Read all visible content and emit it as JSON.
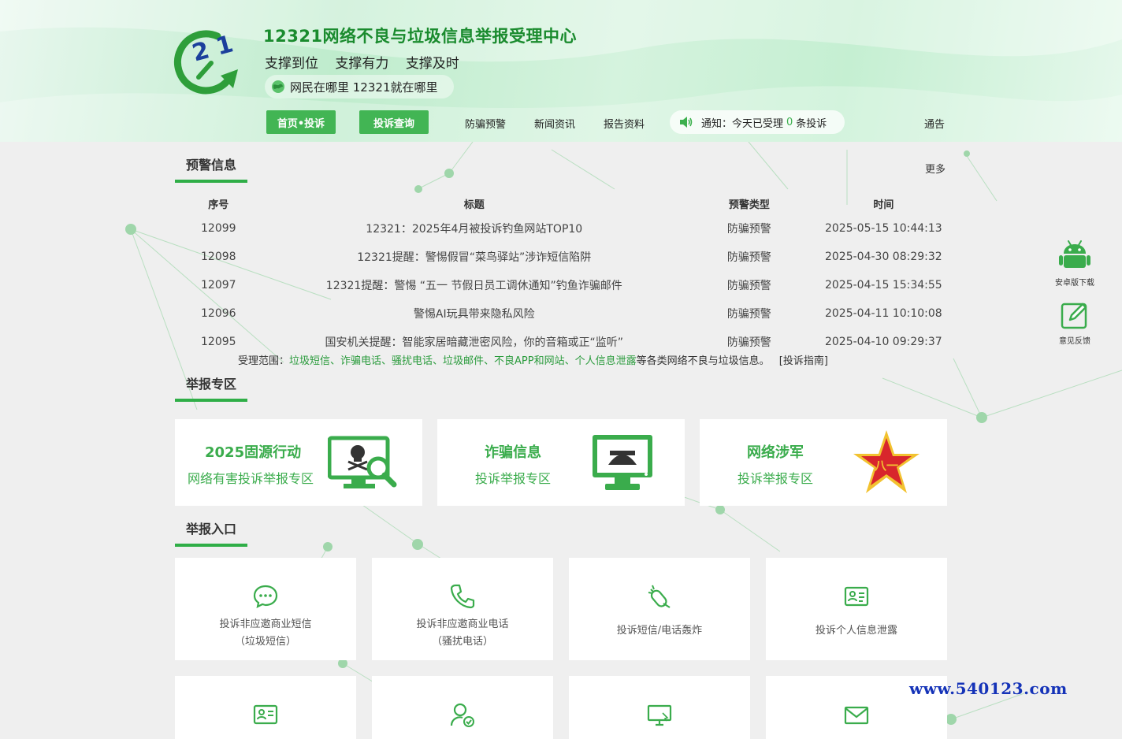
{
  "header": {
    "site_title": "12321网络不良与垃圾信息举报受理中心",
    "slogans": [
      "支撑到位",
      "支撑有力",
      "支撑及时"
    ],
    "motto": "网民在哪里 12321就在哪里",
    "logo_text": "2 1"
  },
  "nav": {
    "home": "首页•投诉",
    "query": "投诉查询",
    "fraud": "防骗预警",
    "news": "新闻资讯",
    "reports": "报告资料",
    "bulletin": "通告",
    "notice_prefix": "通知：今天已受理",
    "notice_count": "0",
    "notice_suffix": "条投诉"
  },
  "warning": {
    "title": "预警信息",
    "more": "更多",
    "columns": [
      "序号",
      "标题",
      "预警类型",
      "时间"
    ],
    "rows": [
      {
        "id": "12099",
        "title": "12321：2025年4月被投诉钓鱼网站TOP10",
        "type": "防骗预警",
        "time": "2025-05-15 10:44:13"
      },
      {
        "id": "12098",
        "title": "12321提醒：警惕假冒“菜鸟驿站”涉诈短信陷阱",
        "type": "防骗预警",
        "time": "2025-04-30 08:29:32"
      },
      {
        "id": "12097",
        "title": "12321提醒：警惕 “五一 节假日员工调休通知”钓鱼诈骗邮件",
        "type": "防骗预警",
        "time": "2025-04-15 15:34:55"
      },
      {
        "id": "12096",
        "title": "警惕AI玩具带来隐私风险",
        "type": "防骗预警",
        "time": "2025-04-11 10:10:08"
      },
      {
        "id": "12095",
        "title": "国安机关提醒：智能家居暗藏泄密风险，你的音箱或正“监听”",
        "type": "防骗预警",
        "time": "2025-04-10 09:29:37"
      }
    ]
  },
  "scope": {
    "prefix": "受理范围：",
    "items": "垃圾短信、诈骗电话、骚扰电话、垃圾邮件、不良APP和网站、个人信息泄露",
    "suffix": "等各类网络不良与垃圾信息。",
    "guide": "[投诉指南]"
  },
  "report_zone": {
    "title": "举报专区",
    "cards": [
      {
        "line1": "2025固源行动",
        "line2": "网络有害投诉举报专区"
      },
      {
        "line1": "诈骗信息",
        "line2": "投诉举报专区"
      },
      {
        "line1": "网络涉军",
        "line2": "投诉举报专区",
        "emblem_text": "八一"
      }
    ]
  },
  "entry": {
    "title": "举报入口",
    "cards": [
      {
        "line1": "投诉非应邀商业短信",
        "line2": "（垃圾短信）",
        "icon": "chat-bubble-icon"
      },
      {
        "line1": "投诉非应邀商业电话",
        "line2": "（骚扰电话）",
        "icon": "phone-icon"
      },
      {
        "line1": "投诉短信/电话轰炸",
        "line2": "",
        "icon": "bomb-icon"
      },
      {
        "line1": "投诉个人信息泄露",
        "line2": "",
        "icon": "id-card-icon"
      }
    ],
    "row2_icons": [
      "id-card-icon",
      "user-check-icon",
      "monitor-icon",
      "envelope-icon"
    ]
  },
  "side": {
    "android": "安卓版下载",
    "feedback": "意见反馈"
  },
  "watermark": "www.540123.com",
  "colors": {
    "brand_green": "#42b554",
    "title_green": "#1a8b2e",
    "watermark_blue": "#1533b8"
  }
}
